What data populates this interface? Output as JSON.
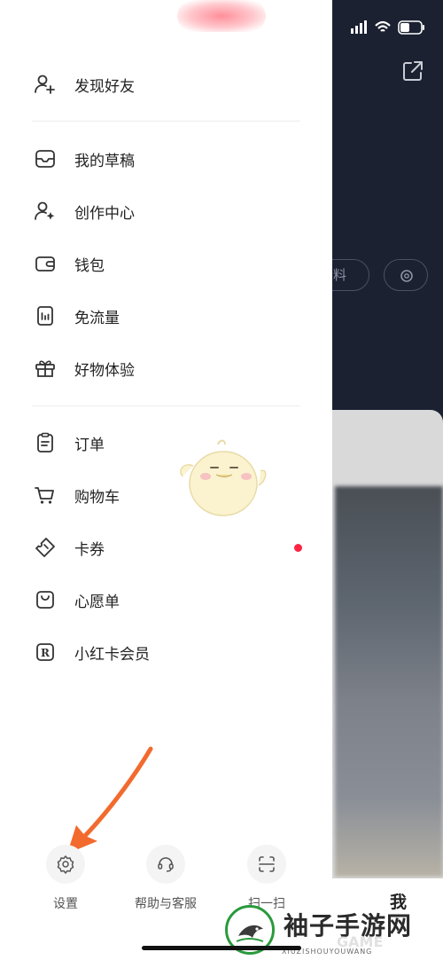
{
  "background": {
    "partial_button_text": "料",
    "bottom_tab_me": "我"
  },
  "menu": {
    "group1": [
      {
        "label": "发现好友",
        "icon": "add-friend-icon"
      }
    ],
    "group2": [
      {
        "label": "我的草稿",
        "icon": "drafts-inbox-icon"
      },
      {
        "label": "创作中心",
        "icon": "creator-center-icon"
      },
      {
        "label": "钱包",
        "icon": "wallet-icon"
      },
      {
        "label": "免流量",
        "icon": "data-free-icon"
      },
      {
        "label": "好物体验",
        "icon": "gift-icon"
      }
    ],
    "group3": [
      {
        "label": "订单",
        "icon": "orders-clipboard-icon"
      },
      {
        "label": "购物车",
        "icon": "shopping-cart-icon"
      },
      {
        "label": "卡券",
        "icon": "coupon-icon",
        "badge_color": "#ff2442"
      },
      {
        "label": "心愿单",
        "icon": "wishlist-bag-icon"
      },
      {
        "label": "小红卡会员",
        "icon": "membership-r-icon"
      }
    ]
  },
  "bottom_actions": [
    {
      "label": "设置",
      "icon": "settings-gear-icon"
    },
    {
      "label": "帮助与客服",
      "icon": "customer-service-headset-icon"
    },
    {
      "label": "扫一扫",
      "icon": "scan-icon"
    }
  ],
  "watermark": {
    "title": "袖子手游网",
    "game_text": "GAME",
    "sub": "XIUZISHOUYOUWANG"
  },
  "colors": {
    "accent_red": "#ff2442",
    "annotation_arrow": "#f26a2e",
    "drawer_bg": "#ffffff",
    "page_bg": "#1b2131"
  }
}
